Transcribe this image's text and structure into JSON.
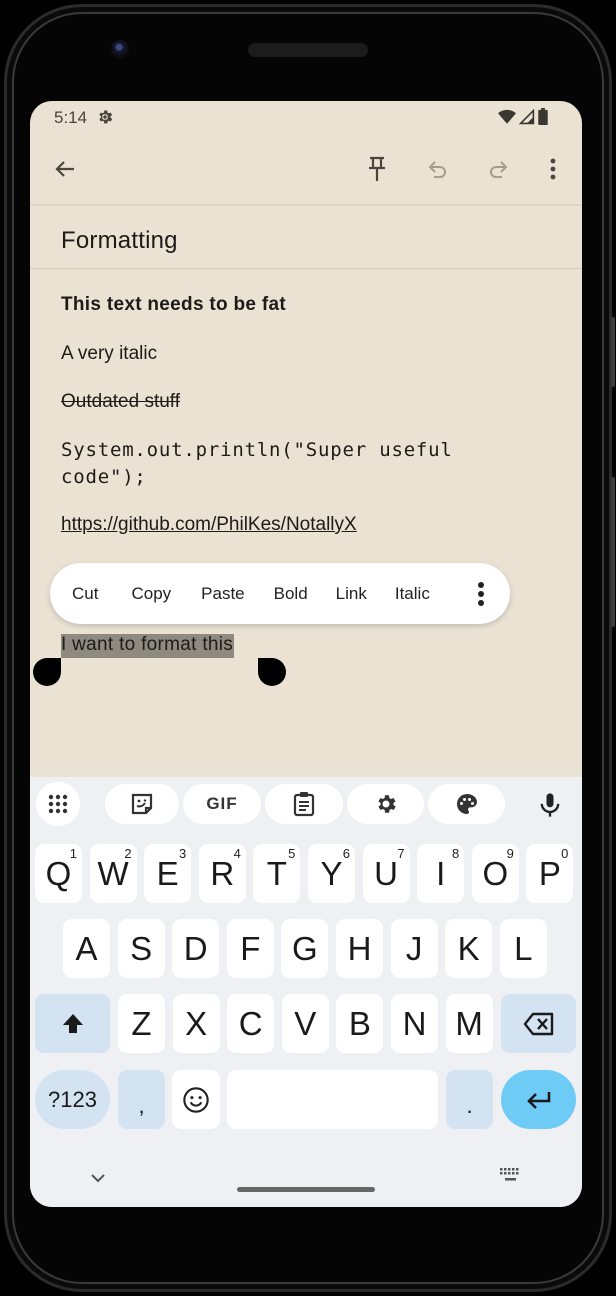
{
  "status_bar": {
    "time": "5:14",
    "left_icons": [
      "settings-gear-icon"
    ],
    "right_icons": [
      "wifi-icon",
      "cellular-signal-icon",
      "battery-icon"
    ]
  },
  "toolbar": {
    "back_icon": "arrow-back-icon",
    "actions": [
      {
        "name": "pin",
        "icon": "pin-icon",
        "enabled": true
      },
      {
        "name": "undo",
        "icon": "undo-icon",
        "enabled": false
      },
      {
        "name": "redo",
        "icon": "redo-icon",
        "enabled": false
      },
      {
        "name": "more",
        "icon": "more-vert-icon",
        "enabled": true
      }
    ]
  },
  "note": {
    "title": "Formatting",
    "lines": {
      "bold": "This text needs to be fat",
      "italic": "A very italic",
      "strikethrough": "Outdated stuff",
      "code": "System.out.println(\"Super useful code\");",
      "link": "https://github.com/PhilKes/NotallyX",
      "selected": "I want to format this"
    }
  },
  "context_menu": {
    "items": [
      "Cut",
      "Copy",
      "Paste",
      "Bold",
      "Link",
      "Italic"
    ],
    "overflow_icon": "more-vert-icon"
  },
  "keyboard": {
    "toolbar": [
      {
        "name": "apps",
        "icon": "apps-grid-icon"
      },
      {
        "name": "sticker",
        "icon": "sticker-icon"
      },
      {
        "name": "gif",
        "label": "GIF"
      },
      {
        "name": "clipboard",
        "icon": "clipboard-icon"
      },
      {
        "name": "settings",
        "icon": "settings-icon"
      },
      {
        "name": "theme",
        "icon": "palette-icon"
      },
      {
        "name": "voice",
        "icon": "microphone-icon"
      }
    ],
    "row1": [
      {
        "k": "Q",
        "h": "1"
      },
      {
        "k": "W",
        "h": "2"
      },
      {
        "k": "E",
        "h": "3"
      },
      {
        "k": "R",
        "h": "4"
      },
      {
        "k": "T",
        "h": "5"
      },
      {
        "k": "Y",
        "h": "6"
      },
      {
        "k": "U",
        "h": "7"
      },
      {
        "k": "I",
        "h": "8"
      },
      {
        "k": "O",
        "h": "9"
      },
      {
        "k": "P",
        "h": "0"
      }
    ],
    "row2": [
      "A",
      "S",
      "D",
      "F",
      "G",
      "H",
      "J",
      "K",
      "L"
    ],
    "row3": [
      "Z",
      "X",
      "C",
      "V",
      "B",
      "N",
      "M"
    ],
    "symbols_label": "?123",
    "comma": ",",
    "period": ".",
    "colors": {
      "key": "#ffffff",
      "special_key": "#d3e3f2",
      "symbols_key": "#b7cad8",
      "enter_key": "#6dcbf6",
      "background": "#eff0f3"
    }
  },
  "theme": {
    "note_background": "#eae3d4",
    "selection": "#8f8a80"
  }
}
